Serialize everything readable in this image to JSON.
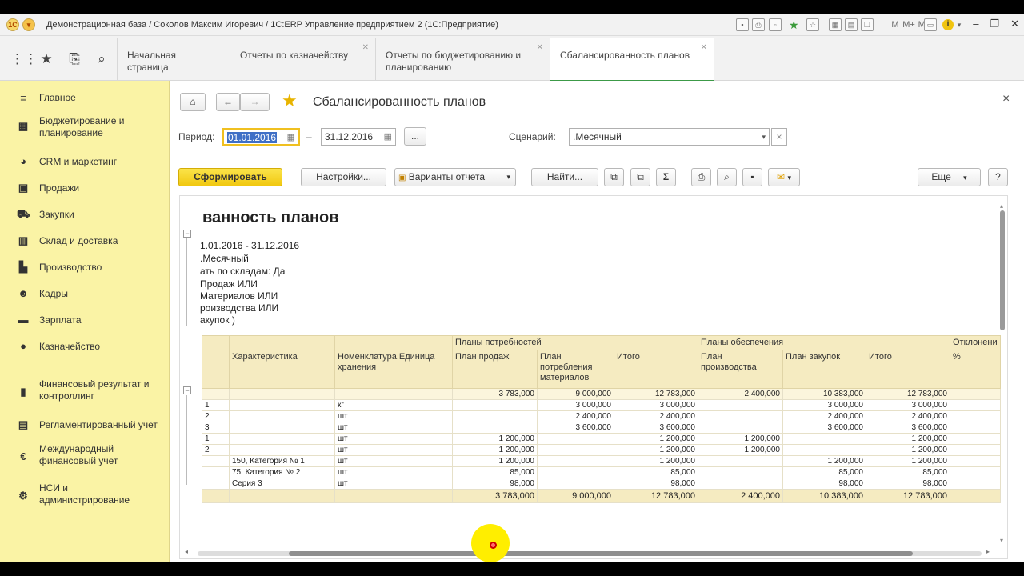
{
  "window": {
    "title": "Демонстрационная база / Соколов Максим Игоревич / 1С:ERP Управление предприятием 2  (1С:Предприятие)",
    "toolbar_m": [
      "M",
      "M+",
      "M-"
    ]
  },
  "tabs": [
    {
      "label": "Начальная страница"
    },
    {
      "label": "Отчеты по казначейству"
    },
    {
      "label": "Отчеты по бюджетированию и планированию"
    },
    {
      "label": "Сбалансированность планов"
    }
  ],
  "sidebar": {
    "items": [
      {
        "label": "Главное",
        "icon": "menu-icon"
      },
      {
        "label": "Бюджетирование и\nпланирование",
        "icon": "chart-icon"
      },
      {
        "label": "CRM и маркетинг",
        "icon": "pie-icon"
      },
      {
        "label": "Продажи",
        "icon": "bag-icon"
      },
      {
        "label": "Закупки",
        "icon": "cart-icon"
      },
      {
        "label": "Склад и доставка",
        "icon": "warehouse-icon"
      },
      {
        "label": "Производство",
        "icon": "factory-icon"
      },
      {
        "label": "Кадры",
        "icon": "person-icon"
      },
      {
        "label": "Зарплата",
        "icon": "wallet-icon"
      },
      {
        "label": "Казначейство",
        "icon": "coin-icon"
      },
      {
        "label": "Финансовый результат и\nконтроллинг",
        "icon": "bars-icon"
      },
      {
        "label": "Регламентированный учет",
        "icon": "ledger-icon"
      },
      {
        "label": "Международный\nфинансовый учет",
        "icon": "euro-icon"
      },
      {
        "label": "НСИ и\nадминистрирование",
        "icon": "gear-icon"
      }
    ]
  },
  "form": {
    "title": "Сбалансированность планов",
    "period_label": "Период:",
    "date_from": "01.01.2016",
    "dash": "–",
    "date_to": "31.12.2016",
    "ellipsis": "...",
    "scenario_label": "Сценарий:",
    "scenario_value": ".Месячный",
    "generate": "Сформировать",
    "settings": "Настройки...",
    "variants": "Варианты отчета",
    "find": "Найти...",
    "sigma": "Σ",
    "more": "Еще",
    "help": "?",
    "close": "×"
  },
  "report": {
    "title": "ванность планов",
    "params": [
      "1.01.2016 - 31.12.2016",
      " .Месячный",
      "ать по складам: Да",
      " Продаж ИЛИ",
      "Материалов ИЛИ",
      "роизводства ИЛИ",
      "акупок )"
    ],
    "group_headers": [
      "Планы потребностей",
      "Планы обеспечения",
      "Отклонени"
    ],
    "headers": [
      "Характеристика",
      "Номенклатура.Единица хранения",
      "План продаж",
      "План потребления материалов",
      "Итого",
      "План производства",
      "План закупок",
      "Итого",
      "%"
    ],
    "rows": [
      {
        "a": "",
        "b": "",
        "c": "",
        "d": "3 783,000",
        "e": "9 000,000",
        "f": "12 783,000",
        "g": "2 400,000",
        "h": "10 383,000",
        "i": "12 783,000"
      },
      {
        "a": "1",
        "b": "",
        "c": "кг",
        "d": "",
        "e": "3 000,000",
        "f": "3 000,000",
        "g": "",
        "h": "3 000,000",
        "i": "3 000,000"
      },
      {
        "a": "2",
        "b": "",
        "c": "шт",
        "d": "",
        "e": "2 400,000",
        "f": "2 400,000",
        "g": "",
        "h": "2 400,000",
        "i": "2 400,000"
      },
      {
        "a": "3",
        "b": "",
        "c": "шт",
        "d": "",
        "e": "3 600,000",
        "f": "3 600,000",
        "g": "",
        "h": "3 600,000",
        "i": "3 600,000"
      },
      {
        "a": " 1",
        "b": "",
        "c": "шт",
        "d": "1 200,000",
        "e": "",
        "f": "1 200,000",
        "g": "1 200,000",
        "h": "",
        "i": "1 200,000"
      },
      {
        "a": " 2",
        "b": "",
        "c": "шт",
        "d": "1 200,000",
        "e": "",
        "f": "1 200,000",
        "g": "1 200,000",
        "h": "",
        "i": "1 200,000"
      },
      {
        "a": "",
        "b": "150, Категория № 1",
        "c": "шт",
        "d": "1 200,000",
        "e": "",
        "f": "1 200,000",
        "g": "",
        "h": "1 200,000",
        "i": "1 200,000"
      },
      {
        "a": "",
        "b": "75, Категория № 2",
        "c": "шт",
        "d": "85,000",
        "e": "",
        "f": "85,000",
        "g": "",
        "h": "85,000",
        "i": "85,000"
      },
      {
        "a": "",
        "b": "Серия 3",
        "c": "шт",
        "d": "98,000",
        "e": "",
        "f": "98,000",
        "g": "",
        "h": "98,000",
        "i": "98,000"
      }
    ],
    "totals": {
      "d": "3 783,000",
      "e": "9 000,000",
      "f": "12 783,000",
      "g": "2 400,000",
      "h": "10 383,000",
      "i": "12 783,000"
    }
  }
}
